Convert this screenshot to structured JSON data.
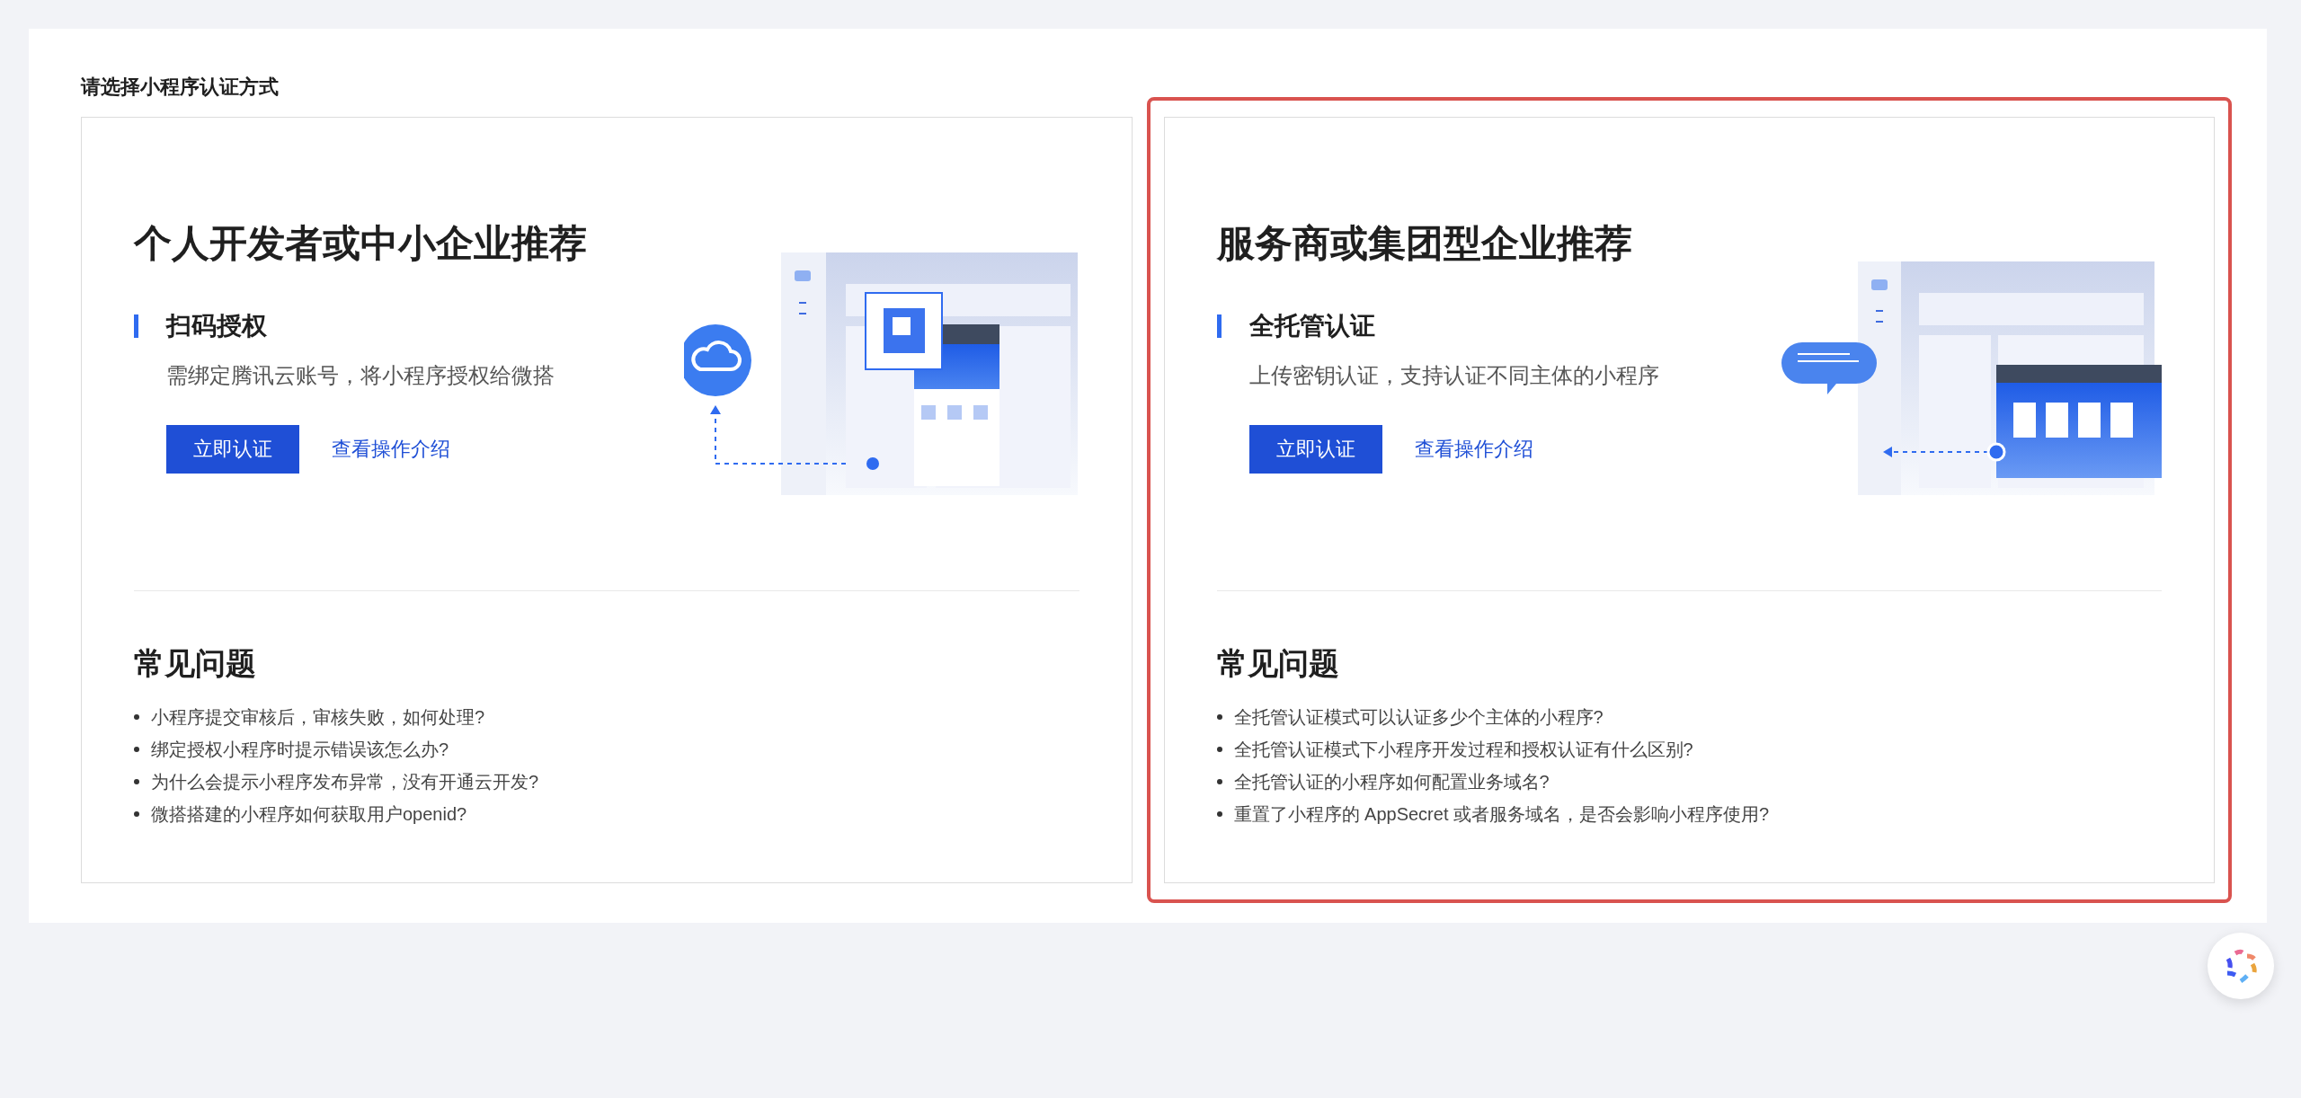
{
  "heading": "请选择小程序认证方式",
  "options": [
    {
      "selected": false,
      "kind": "qr",
      "title": "个人开发者或中小企业推荐",
      "method": "扫码授权",
      "description": "需绑定腾讯云账号，将小程序授权给微搭",
      "primary_button": "立即认证",
      "link": "查看操作介绍",
      "faq_title": "常见问题",
      "faq": [
        "小程序提交审核后，审核失败，如何处理?",
        "绑定授权小程序时提示错误该怎么办?",
        "为什么会提示小程序发布异常，没有开通云开发?",
        "微搭搭建的小程序如何获取用户openid?"
      ]
    },
    {
      "selected": true,
      "kind": "hosted",
      "title": "服务商或集团型企业推荐",
      "method": "全托管认证",
      "description": "上传密钥认证，支持认证不同主体的小程序",
      "primary_button": "立即认证",
      "link": "查看操作介绍",
      "faq_title": "常见问题",
      "faq": [
        "全托管认证模式可以认证多少个主体的小程序?",
        "全托管认证模式下小程序开发过程和授权认证有什么区别?",
        "全托管认证的小程序如何配置业务域名?",
        "重置了小程序的 AppSecret 或者服务域名，是否会影响小程序使用?"
      ]
    }
  ]
}
